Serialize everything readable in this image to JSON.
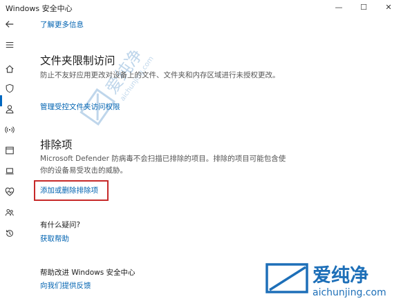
{
  "window": {
    "title": "Windows 安全中心",
    "controls": {
      "minimize": "—",
      "maximize": "☐",
      "close": "✕"
    }
  },
  "sidebar": {
    "items": [
      {
        "icon": "back-arrow-icon"
      },
      {
        "icon": "hamburger-menu-icon"
      },
      {
        "icon": "home-icon"
      },
      {
        "icon": "shield-icon",
        "active": true
      },
      {
        "icon": "account-person-icon"
      },
      {
        "icon": "network-signal-icon"
      },
      {
        "icon": "app-browser-icon"
      },
      {
        "icon": "device-laptop-icon"
      },
      {
        "icon": "health-heart-icon"
      },
      {
        "icon": "family-icon"
      },
      {
        "icon": "history-icon"
      }
    ],
    "accent_color": "#0067c0"
  },
  "main": {
    "learn_more_link": "了解更多信息",
    "folder_access": {
      "title": "文件夹限制访问",
      "description": "防止不友好应用更改对设备上的文件、文件夹和内存区域进行未授权更改。",
      "link": "管理受控文件夹访问权限"
    },
    "exclusions": {
      "title": "排除项",
      "description": "Microsoft Defender 防病毒不会扫描已排除的项目。排除的项目可能包含使你的设备易受攻击的威胁。",
      "link": "添加或删除排除项"
    },
    "questions": {
      "title": "有什么疑问?",
      "link": "获取帮助"
    },
    "improve": {
      "title": "帮助改进 Windows 安全中心",
      "link": "向我们提供反馈"
    }
  },
  "watermark": {
    "brand": "爱纯净",
    "url": "aichunjing.com"
  },
  "colors": {
    "link": "#0063b1",
    "highlight": "#c62828",
    "watermark": "#1d6fb8"
  }
}
